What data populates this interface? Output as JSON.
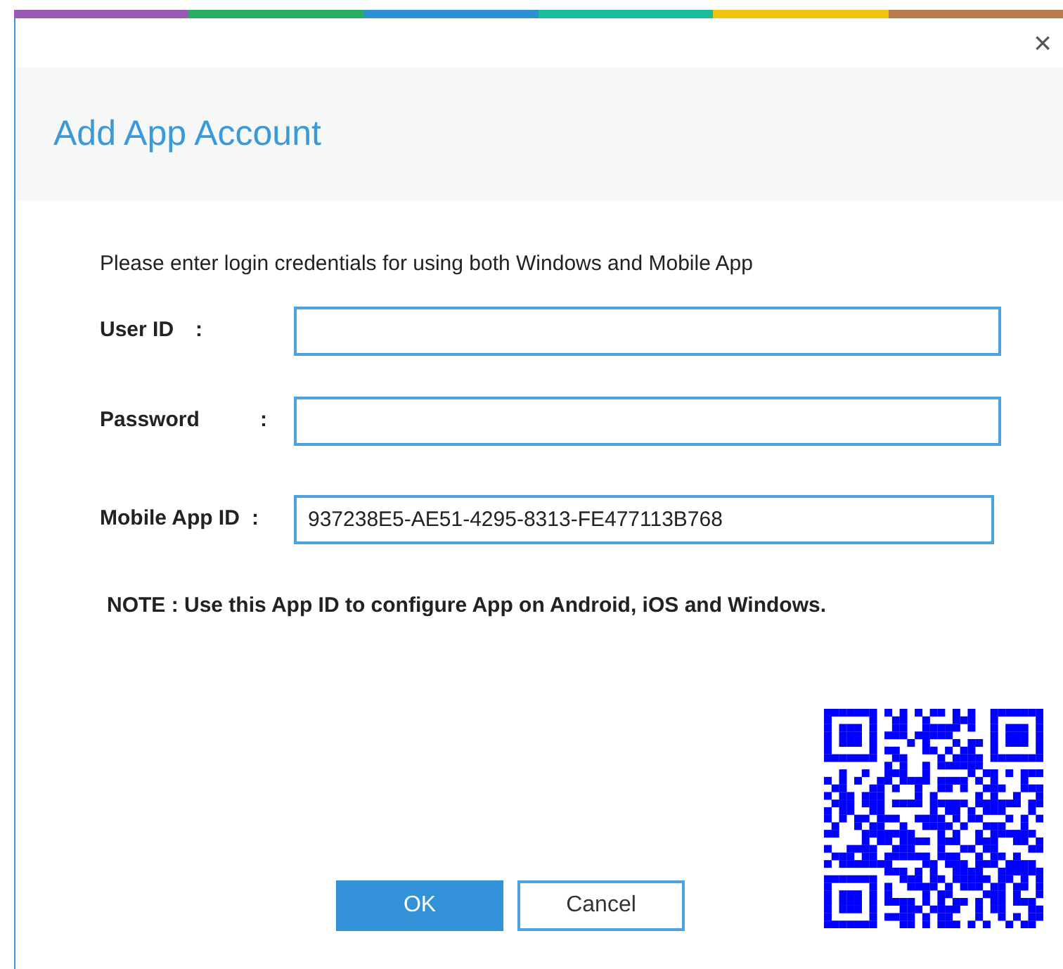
{
  "window": {
    "title": "Add App Account",
    "close": "×"
  },
  "instruction": "Please enter login credentials for using both Windows and Mobile App",
  "fields": [
    {
      "label": "User ID",
      "colon": ":"
    },
    {
      "label": "Password",
      "colon": ":"
    },
    {
      "label": "Mobile App ID",
      "colon": ":",
      "value": "937238E5-AE51-4295-8313-FE477113B768"
    }
  ],
  "note": "NOTE : Use this App ID to configure App on Android, iOS and Windows.",
  "buttons": [
    {
      "label": "OK",
      "kind": "primary"
    },
    {
      "label": "Cancel",
      "kind": "secondary"
    }
  ]
}
